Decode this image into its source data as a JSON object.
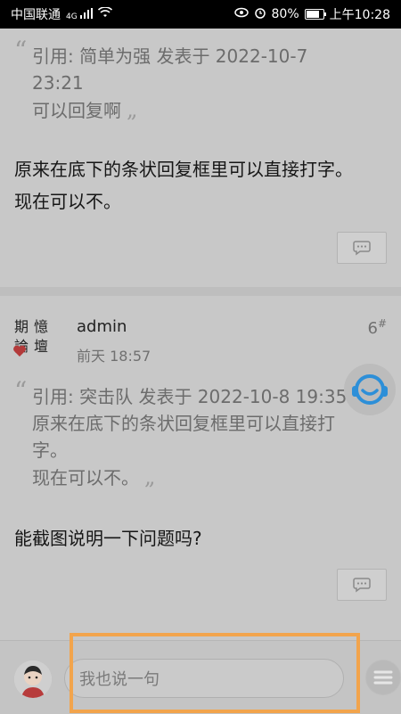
{
  "status_bar": {
    "carrier": "中国联通",
    "signal_label": "4G",
    "battery": "80%",
    "battery_level": 0.8,
    "time": "上午10:28"
  },
  "post_top": {
    "quote": {
      "line1": "引用: 简单为强 发表于 2022-10-7",
      "line2": "23:21",
      "line3": "可以回复啊"
    },
    "body_line1": "原来在底下的条状回复框里可以直接打字。",
    "body_line2": "现在可以不。"
  },
  "post_6": {
    "logo_text": [
      "期",
      "憶",
      "論",
      "壇"
    ],
    "username": "admin",
    "time": "前天 18:57",
    "floor": "6",
    "floor_suffix": "#",
    "quote": {
      "line1": "引用: 突击队 发表于 2022-10-8 19:35",
      "line2": "原来在底下的条状回复框里可以直接打",
      "line3": "字。",
      "line4": "现在可以不。"
    },
    "body": "能截图说明一下问题吗?"
  },
  "bottom_bar": {
    "input_placeholder": "我也说一句"
  },
  "colors": {
    "highlight": "#f2a44c",
    "service_icon": "#2d8fd8"
  }
}
